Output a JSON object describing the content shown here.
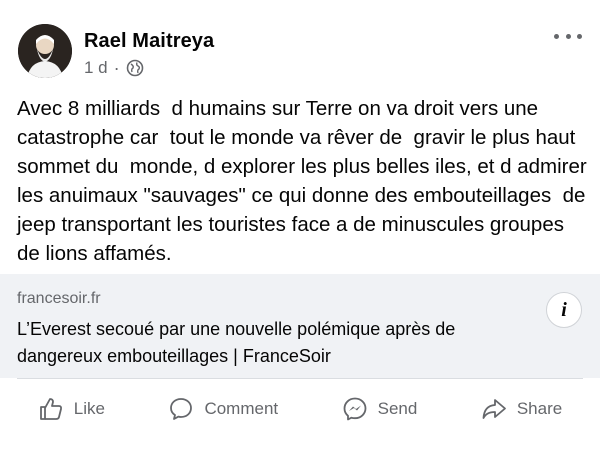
{
  "post": {
    "author": "Rael Maitreya",
    "time": "1 d",
    "separator": "·",
    "privacy_icon": "globe-icon",
    "more_icon": "more-options-icon",
    "text": "Avec 8 milliards  d humains sur Terre on va droit vers une catastrophe car  tout le monde va rêver de  gravir le plus haut sommet du  monde, d explorer les plus belles iles, et d admirer les anuimaux \"sauvages\" ce qui donne des embouteillages  de jeep transportant les touristes face a de minuscules groupes de lions affamés."
  },
  "link": {
    "domain": "francesoir.fr",
    "title": "L’Everest secoué par une nouvelle polémique après de dangereux embouteillages | FranceSoir",
    "info_label": "i"
  },
  "actions": {
    "like": "Like",
    "comment": "Comment",
    "send": "Send",
    "share": "Share"
  },
  "colors": {
    "secondary_text": "#65676b",
    "card_bg": "#f0f2f5",
    "divider": "#dadde1"
  }
}
